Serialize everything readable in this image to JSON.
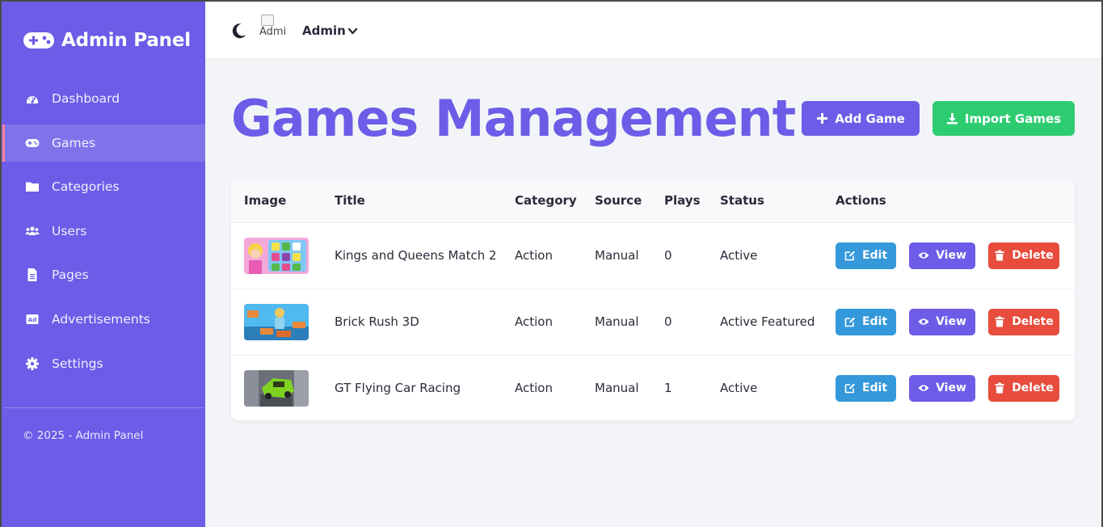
{
  "brand": {
    "title": "Admin Panel",
    "icon": "gamepad-icon"
  },
  "sidebar": {
    "items": [
      {
        "label": "Dashboard",
        "icon": "dashboard-icon",
        "active": false
      },
      {
        "label": "Games",
        "icon": "gamepad-icon",
        "active": true
      },
      {
        "label": "Categories",
        "icon": "folder-icon",
        "active": false
      },
      {
        "label": "Users",
        "icon": "users-icon",
        "active": false
      },
      {
        "label": "Pages",
        "icon": "file-icon",
        "active": false
      },
      {
        "label": "Advertisements",
        "icon": "ad-icon",
        "active": false
      },
      {
        "label": "Settings",
        "icon": "gear-icon",
        "active": false
      }
    ],
    "footer": "© 2025 - Admin Panel"
  },
  "topbar": {
    "avatar_alt": "Admi",
    "user_name": "Admin"
  },
  "page": {
    "title": "Games Management",
    "add_label": "Add Game",
    "import_label": "Import Games"
  },
  "table": {
    "headers": [
      "Image",
      "Title",
      "Category",
      "Source",
      "Plays",
      "Status",
      "Actions"
    ],
    "rows": [
      {
        "title": "Kings and Queens Match 2",
        "category": "Action",
        "source": "Manual",
        "plays": "0",
        "status": "Active"
      },
      {
        "title": "Brick Rush 3D",
        "category": "Action",
        "source": "Manual",
        "plays": "0",
        "status": "Active Featured"
      },
      {
        "title": "GT Flying Car Racing",
        "category": "Action",
        "source": "Manual",
        "plays": "1",
        "status": "Active"
      }
    ],
    "edit_label": "Edit",
    "view_label": "View",
    "delete_label": "Delete"
  },
  "colors": {
    "primary": "#6c5ce7",
    "success": "#2ecc71",
    "info": "#3498db",
    "danger": "#e74c3c",
    "active_indicator": "#ff7f9a"
  }
}
